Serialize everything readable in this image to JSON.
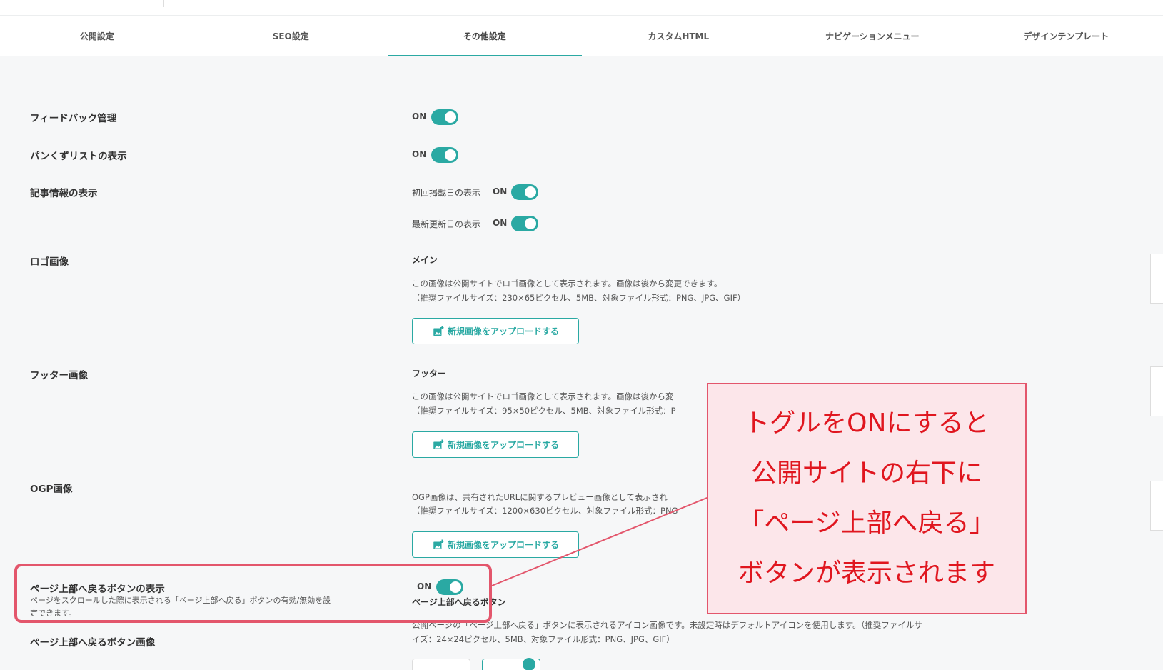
{
  "tabs": [
    {
      "label": "公開設定"
    },
    {
      "label": "SEO設定"
    },
    {
      "label": "その他設定"
    },
    {
      "label": "カスタムHTML"
    },
    {
      "label": "ナビゲーションメニュー"
    },
    {
      "label": "デザインテンプレート"
    }
  ],
  "active_tab": "その他設定",
  "accent_color": "#2aa9a3",
  "annotation_color": "#e3566c",
  "settings": {
    "feedback": {
      "label": "フィードバック管理",
      "toggle_text": "ON",
      "enabled": true
    },
    "breadcrumb": {
      "label": "パンくずリストの表示",
      "toggle_text": "ON",
      "enabled": true
    },
    "article_info": {
      "label": "記事情報の表示",
      "first_published": {
        "label": "初回掲載日の表示",
        "toggle_text": "ON",
        "enabled": true
      },
      "last_updated": {
        "label": "最新更新日の表示",
        "toggle_text": "ON",
        "enabled": true
      }
    },
    "logo": {
      "label": "ロゴ画像",
      "sub_label": "メイン",
      "desc1": "この画像は公開サイトでロゴ画像として表示されます。画像は後から変更できます。",
      "desc2": "（推奨ファイルサイズ：230×65ピクセル、5MB、対象ファイル形式：PNG、JPG、GIF）",
      "upload_label": "新規画像をアップロードする"
    },
    "footer": {
      "label": "フッター画像",
      "sub_label": "フッター",
      "desc1": "この画像は公開サイトでロゴ画像として表示されます。画像は後から変",
      "desc2": "（推奨ファイルサイズ：95×50ピクセル、5MB、対象ファイル形式：P",
      "upload_label": "新規画像をアップロードする"
    },
    "ogp": {
      "label": "OGP画像",
      "desc1": "OGP画像は、共有されたURLに関するプレビュー画像として表示され",
      "desc2": "（推奨ファイルサイズ：1200×630ピクセル、対象ファイル形式：PNG",
      "upload_label": "新規画像をアップロードする"
    },
    "back_to_top": {
      "label": "ページ上部へ戻るボタンの表示",
      "desc1": "ページをスクロールした際に表示される「ページ上部へ戻る」ボタンの有効/無効を設",
      "desc2": "定できます。",
      "toggle_text": "ON",
      "enabled": true,
      "right_label": "ページ上部へ戻るボタン"
    },
    "back_to_top_image": {
      "label": "ページ上部へ戻るボタン画像",
      "desc1": "公開ページの「ページ上部へ戻る」ボタンに表示されるアイコン画像です。未設定時はデフォルトアイコンを使用します。（推奨ファイルサ",
      "desc2": "イズ：24×24ピクセル、5MB、対象ファイル形式：PNG、JPG、GIF）"
    }
  },
  "callout": {
    "lines": [
      "トグルをONにすると",
      "公開サイトの右下に",
      "「ページ上部へ戻る」",
      "ボタンが表示されます"
    ]
  }
}
